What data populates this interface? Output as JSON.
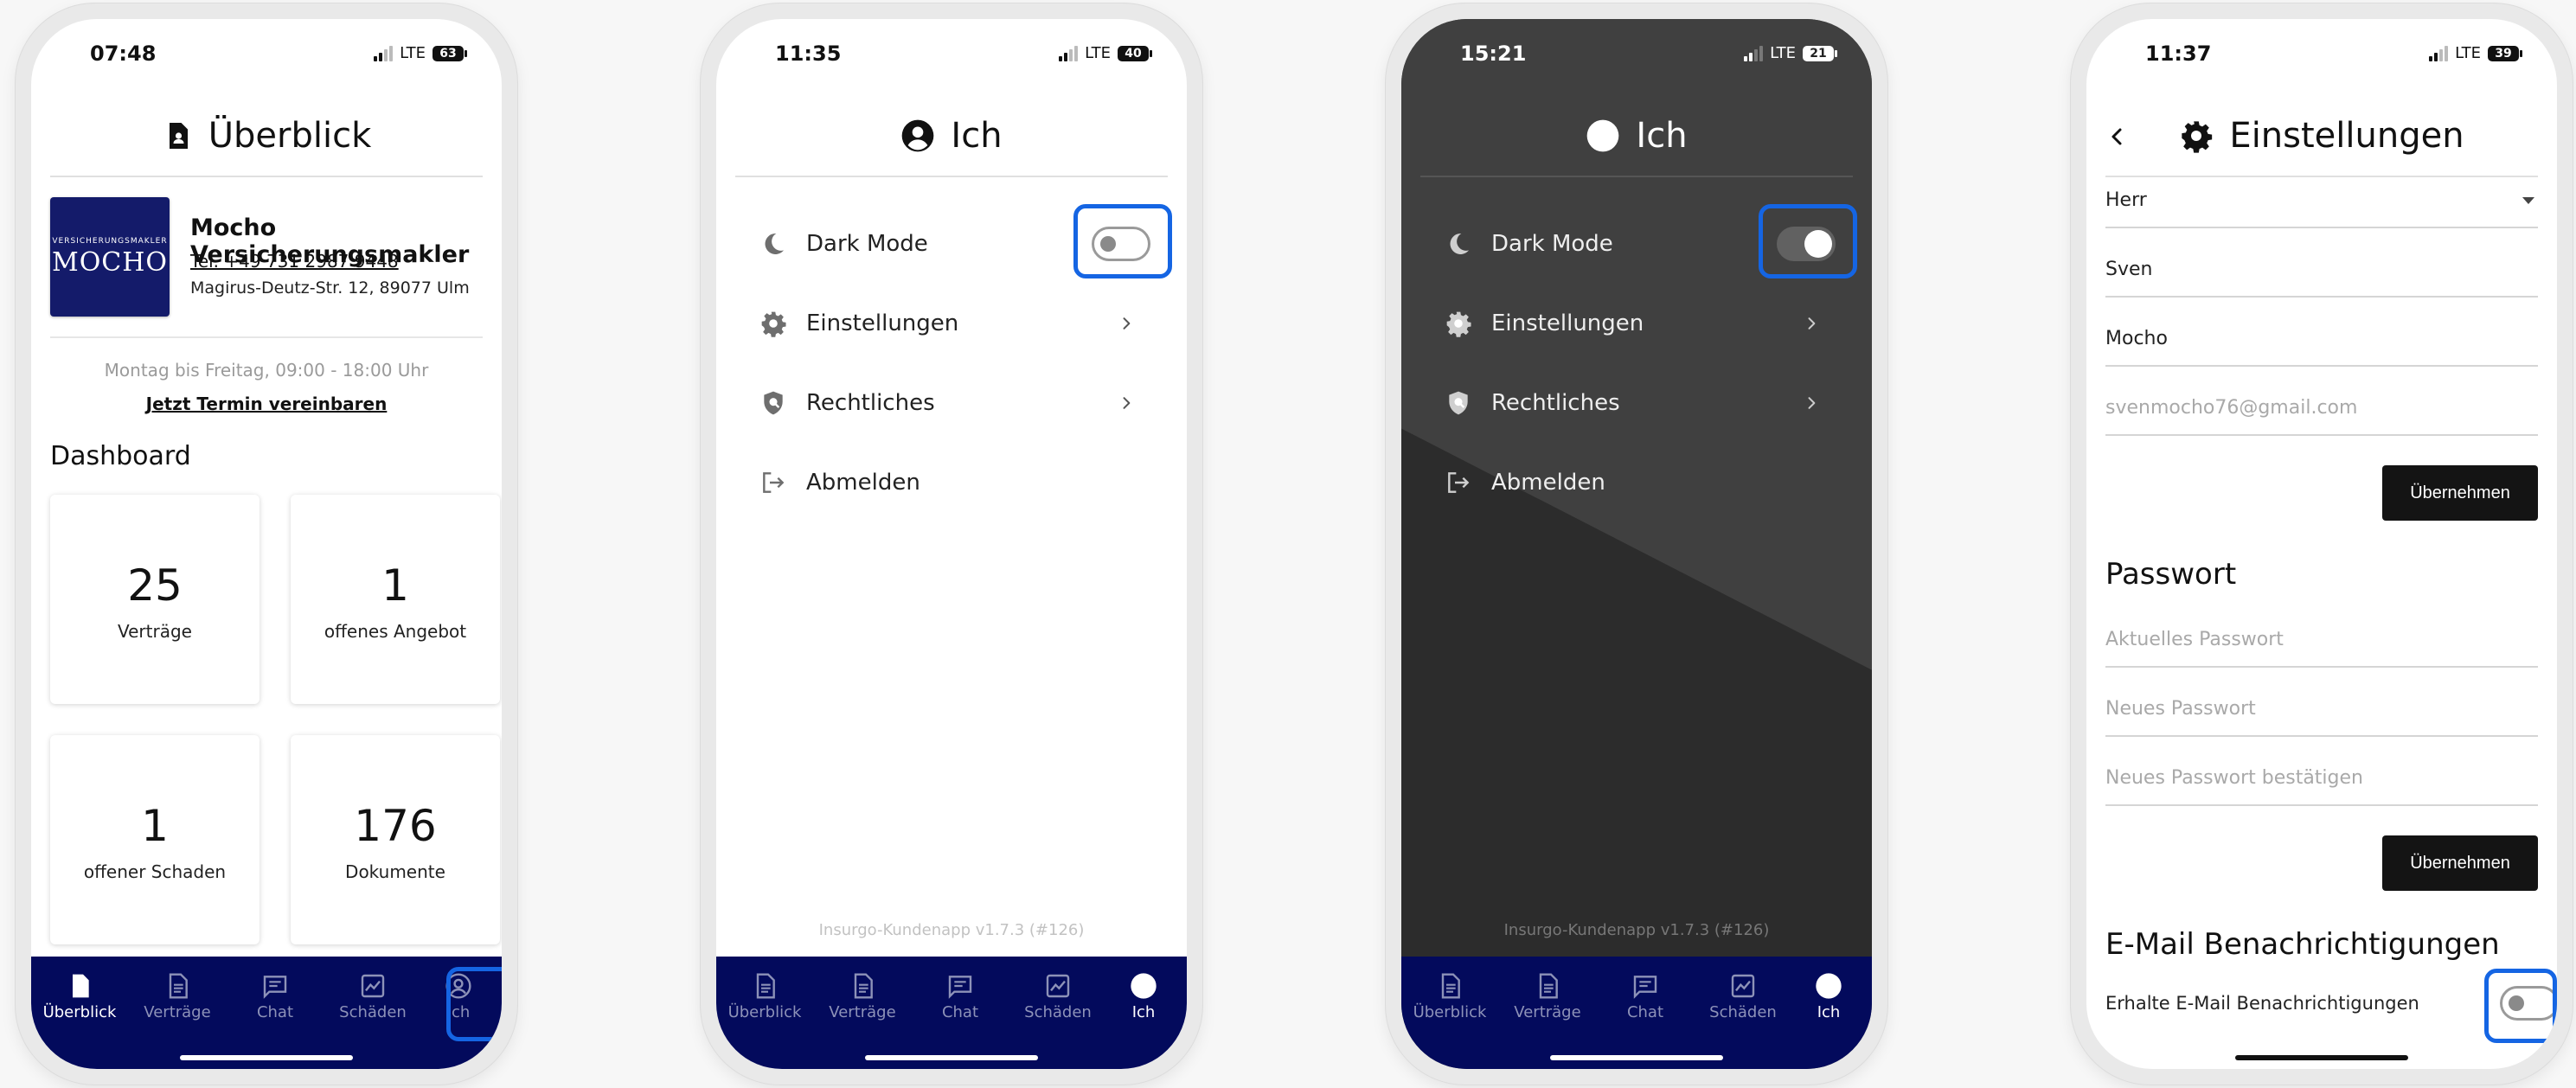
{
  "common": {
    "network": "LTE",
    "version": "Insurgo-Kundenapp v1.7.3 (#126)",
    "tabs": [
      "Überblick",
      "Verträge",
      "Chat",
      "Schäden",
      "Ich"
    ]
  },
  "phone1": {
    "time": "07:48",
    "battery": "63",
    "title": "Überblick",
    "logo_small": "VERSICHERUNGSMAKLER",
    "logo_big": "MOCHO",
    "broker_name": "Mocho Versicherungsmakler",
    "broker_tel": "Tel. +49 731 2987 9448",
    "broker_address": "Magirus-Deutz-Str. 12, 89077 Ulm",
    "hours": "Montag bis Freitag, 09:00 - 18:00 Uhr",
    "appointment_link": "Jetzt Termin vereinbaren",
    "dashboard_title": "Dashboard",
    "cards": [
      {
        "value": "25",
        "label": "Verträge"
      },
      {
        "value": "1",
        "label": "offenes Angebot"
      },
      {
        "value": "1",
        "label": "offener Schaden"
      },
      {
        "value": "176",
        "label": "Dokumente"
      }
    ],
    "active_tab": "Überblick",
    "highlighted": "Ich tab"
  },
  "phone2": {
    "time": "11:35",
    "battery": "40",
    "title": "Ich",
    "menu": [
      "Dark Mode",
      "Einstellungen",
      "Rechtliches",
      "Abmelden"
    ],
    "dark_mode_on": false,
    "active_tab": "Ich"
  },
  "phone3": {
    "time": "15:21",
    "battery": "21",
    "title": "Ich",
    "menu": [
      "Dark Mode",
      "Einstellungen",
      "Rechtliches",
      "Abmelden"
    ],
    "dark_mode_on": true,
    "active_tab": "Ich"
  },
  "phone4": {
    "time": "11:37",
    "battery": "39",
    "title": "Einstellungen",
    "salutation": "Herr",
    "first_name": "Sven",
    "last_name": "Mocho",
    "email_placeholder": "svenmocho76@gmail.com",
    "apply_label": "Übernehmen",
    "password_title": "Passwort",
    "current_password_placeholder": "Aktuelles Passwort",
    "new_password_placeholder": "Neues Passwort",
    "confirm_password_placeholder": "Neues Passwort bestätigen",
    "notifications_title": "E-Mail Benachrichtigungen",
    "notifications_label": "Erhalte E-Mail Benachrichtigungen",
    "notifications_on": false
  },
  "colors": {
    "tabbar": "#030a5c",
    "highlight": "#1565e3",
    "dark_bg": "#2c2c2c"
  }
}
